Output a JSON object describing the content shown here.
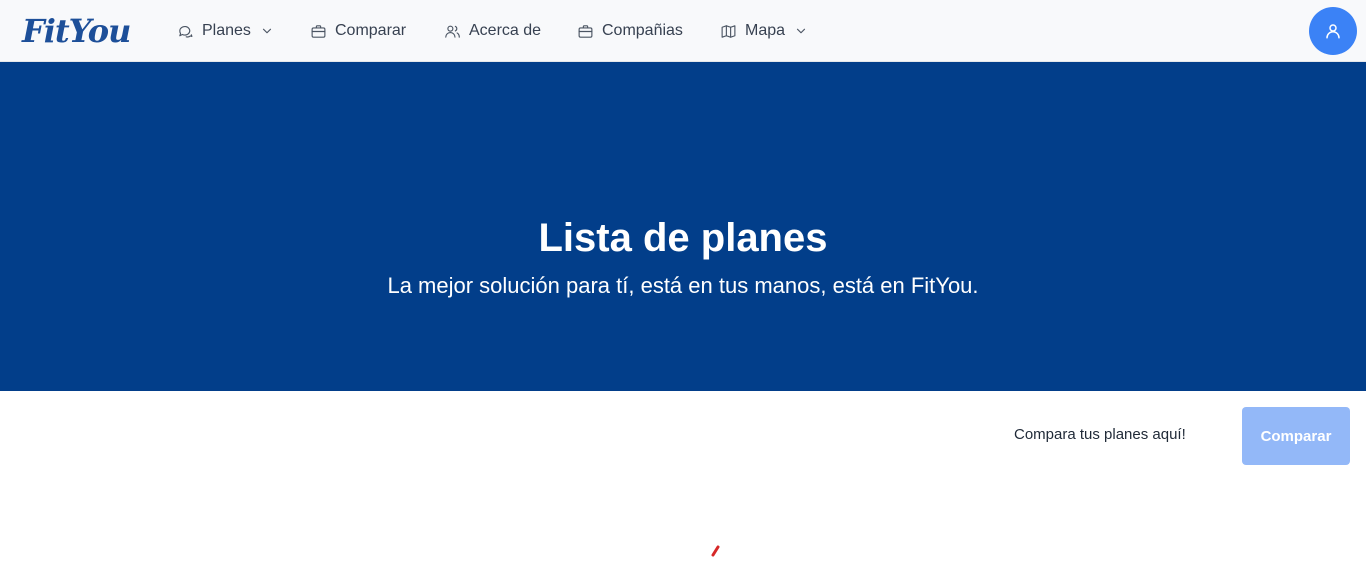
{
  "brand": {
    "logo_text": "FitYou",
    "logo_colors": {
      "text": "#1d4f99",
      "accent": "#2a8fd6"
    }
  },
  "nav": {
    "items": [
      {
        "label": "Planes",
        "icon": "chat-bubbles-icon",
        "has_dropdown": true
      },
      {
        "label": "Comparar",
        "icon": "briefcase-icon",
        "has_dropdown": false
      },
      {
        "label": "Acerca de",
        "icon": "users-icon",
        "has_dropdown": false
      },
      {
        "label": "Compañias",
        "icon": "briefcase-icon",
        "has_dropdown": false
      },
      {
        "label": "Mapa",
        "icon": "map-icon",
        "has_dropdown": true
      }
    ],
    "user_icon": "user-icon"
  },
  "hero": {
    "title": "Lista de planes",
    "subtitle": "La mejor solución para tí, está en tus manos, está en FitYou."
  },
  "compare": {
    "prompt": "Compara tus planes aquí!",
    "button_label": "Comparar"
  },
  "loading": {
    "icon": "spinner-icon"
  },
  "colors": {
    "navbar_bg": "#f8f9fb",
    "hero_bg": "#023e8a",
    "primary": "#3b82f6",
    "button_disabled": "#93b8f8",
    "spinner": "#d62828"
  }
}
